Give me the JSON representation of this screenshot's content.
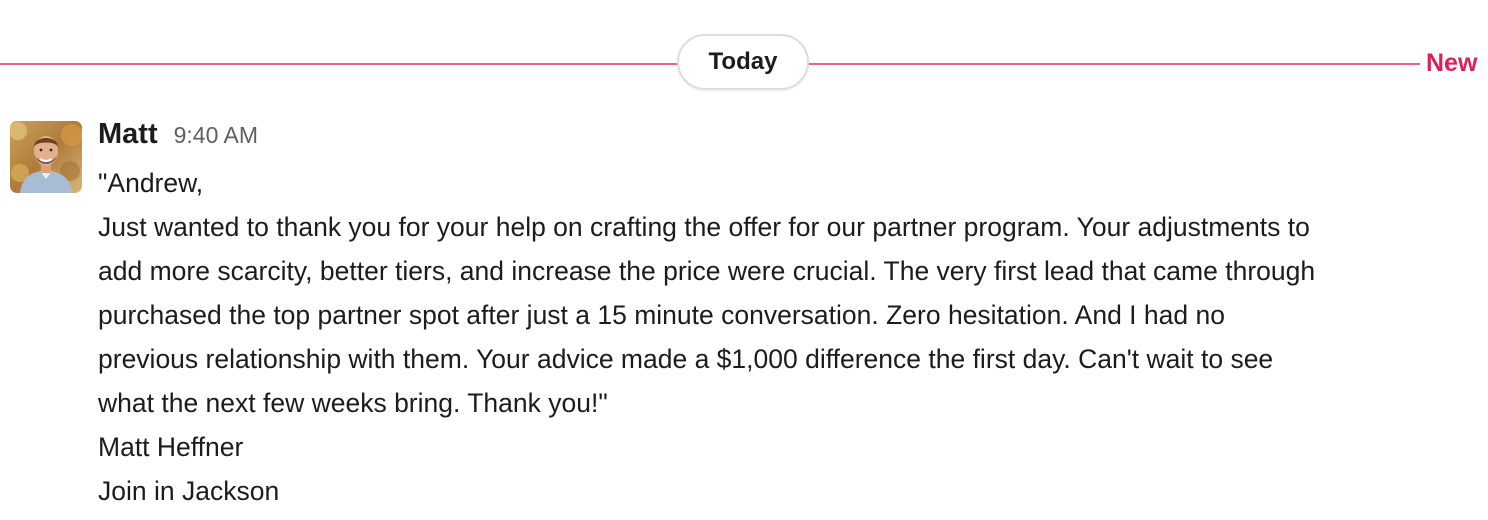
{
  "divider": {
    "date_label": "Today",
    "new_label": "New",
    "line_color": "#e8638f",
    "new_color": "#e01e5a"
  },
  "message": {
    "sender": "Matt",
    "time": "9:40 AM",
    "avatar_icon": "user-photo-avatar",
    "lines": [
      "\"Andrew,",
      "Just wanted to thank you for your help on crafting the offer for our partner program. Your adjustments to",
      "add more scarcity, better tiers, and increase the price were crucial. The very first lead that came through",
      "purchased the top partner spot after just a 15 minute conversation. Zero hesitation. And I had no",
      "previous relationship with them. Your advice made a $1,000 difference the first day. Can't wait to see",
      "what the next few weeks bring. Thank you!\"",
      "Matt Heffner",
      "Join in Jackson"
    ]
  }
}
